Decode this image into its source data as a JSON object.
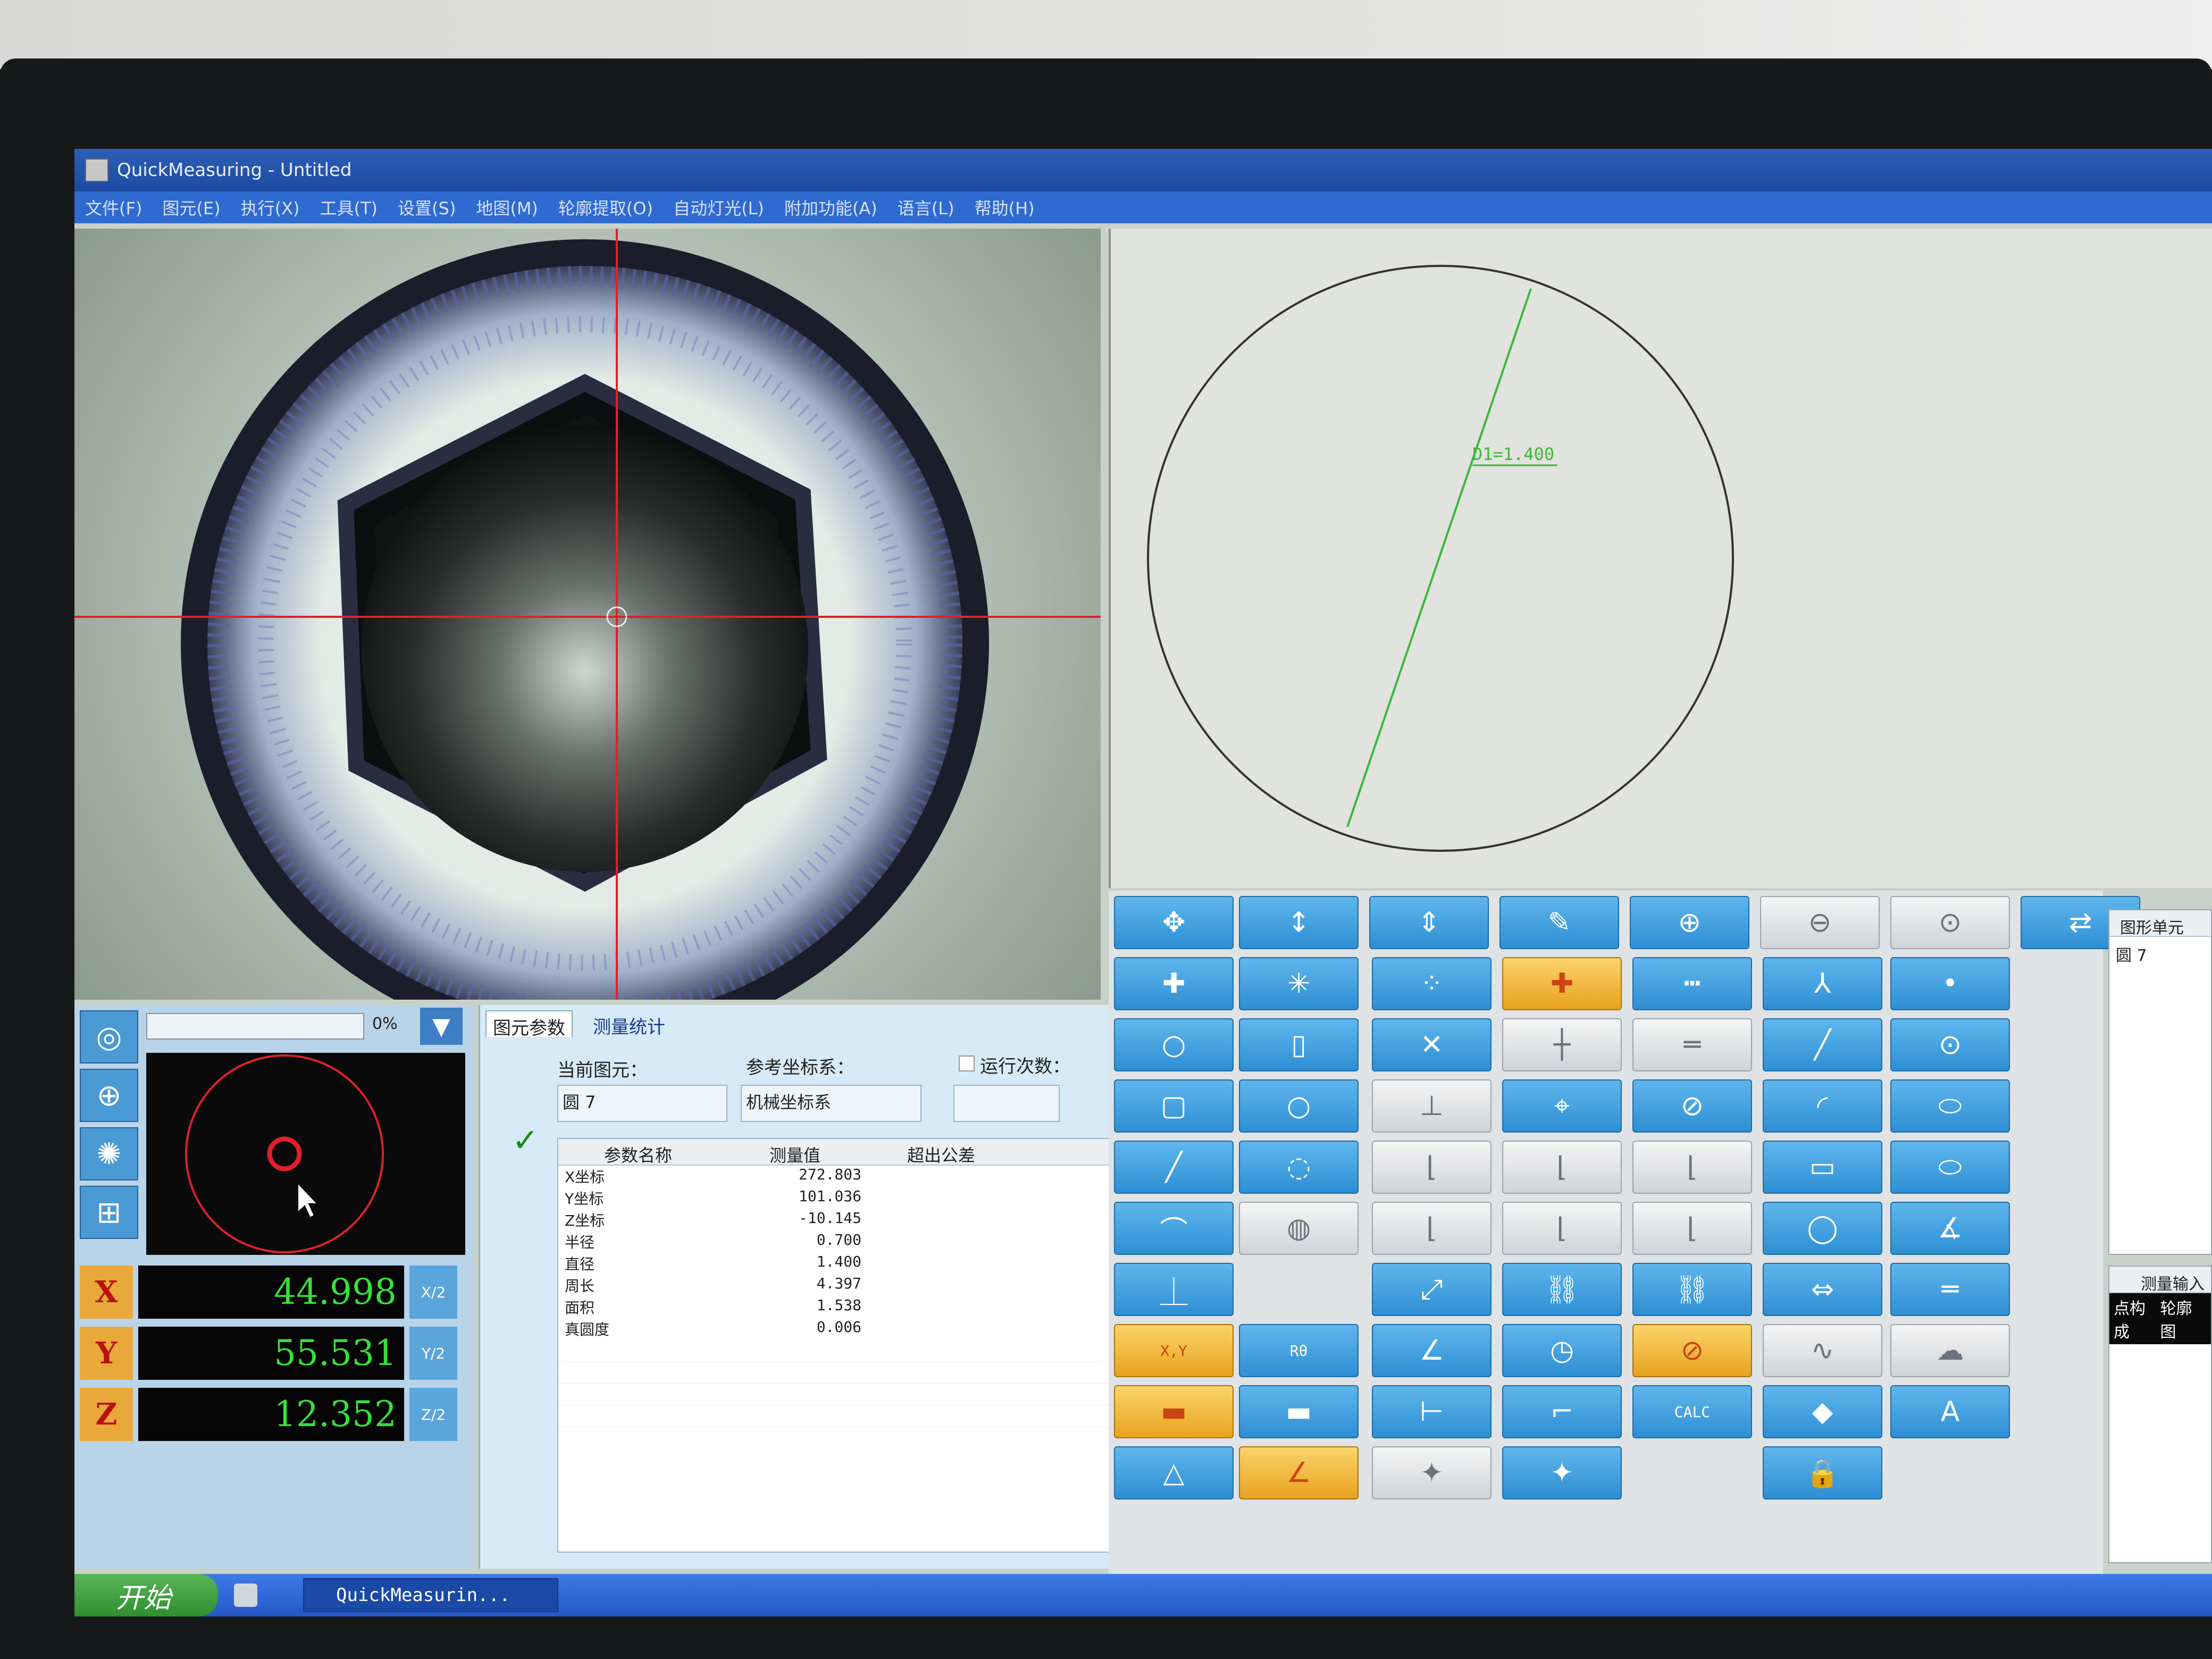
{
  "window": {
    "title": "QuickMeasuring - Untitled"
  },
  "menu": [
    "文件(F)",
    "图元(E)",
    "执行(X)",
    "工具(T)",
    "设置(S)",
    "地图(M)",
    "轮廓提取(O)",
    "自动灯光(L)",
    "附加功能(A)",
    "语言(L)",
    "帮助(H)"
  ],
  "drawing": {
    "dimension_label": "D1=1.400"
  },
  "dro": {
    "progress_percent": 0,
    "progress_text": "0%",
    "axes": [
      {
        "tag": "X",
        "value": "44.998",
        "half": "X/2"
      },
      {
        "tag": "Y",
        "value": "55.531",
        "half": "Y/2"
      },
      {
        "tag": "Z",
        "value": "12.352",
        "half": "Z/2"
      }
    ]
  },
  "params": {
    "tabs": [
      "图元参数",
      "测量统计"
    ],
    "current_element_label": "当前图元：",
    "current_element_value": "圆 7",
    "ref_coord_label": "参考坐标系：",
    "ref_coord_value": "机械坐标系",
    "run_count_label": "运行次数：",
    "table_headers": [
      "参数名称",
      "测量值",
      "超出公差"
    ],
    "rows": [
      {
        "name": "X坐标",
        "value": "272.803"
      },
      {
        "name": "Y坐标",
        "value": "101.036"
      },
      {
        "name": "Z坐标",
        "value": "-10.145"
      },
      {
        "name": "半径",
        "value": "0.700"
      },
      {
        "name": "直径",
        "value": "1.400"
      },
      {
        "name": "周长",
        "value": "4.397"
      },
      {
        "name": "面积",
        "value": "1.538"
      },
      {
        "name": "真圆度",
        "value": "0.006"
      }
    ]
  },
  "toolbar_text": {
    "xy": "X,Y",
    "rtheta": "Rθ",
    "calc": "CALC",
    "text_tool": "A"
  },
  "elements_panel": {
    "title": "图形单元",
    "items": [
      "圆 7"
    ]
  },
  "meas_input": {
    "title": "测量输入",
    "left": "点构成",
    "right": "轮廓图"
  },
  "taskbar": {
    "start": "开始",
    "task": "QuickMeasurin..."
  },
  "colors": {
    "accent": "#2e8fd4",
    "active": "#e8a31f",
    "dro_text": "#36e03a",
    "crosshair": "#e0202a"
  }
}
